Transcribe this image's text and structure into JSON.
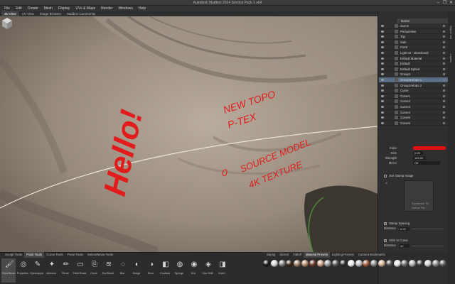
{
  "window": {
    "title": "Autodesk Mudbox 2014 Service Pack 1 x64",
    "controls": [
      "–",
      "❐",
      "✕"
    ]
  },
  "menu": {
    "items": [
      "File",
      "Edit",
      "Create",
      "Mesh",
      "Display",
      "UVs & Maps",
      "Render",
      "Windows",
      "Help"
    ]
  },
  "view_tabs": {
    "items": [
      "3D View",
      "UV View",
      "Image Browser",
      "Mudbox Community"
    ],
    "active": 0
  },
  "viewport": {
    "annotations": {
      "hello": "Hello!",
      "new_topo": "NEW TOPO",
      "ptex": "P-TEX",
      "zero": "0",
      "source_model": "SOURCE MODEL",
      "texture": "4K TEXTURE"
    },
    "annotation_color": "#e21b1b"
  },
  "outliner": {
    "header": "Name",
    "rows": [
      {
        "name": "Scene",
        "icon": "scene-icon"
      },
      {
        "name": "Perspective",
        "icon": "camera-icon"
      },
      {
        "name": "Top",
        "icon": "camera-icon"
      },
      {
        "name": "Side",
        "icon": "camera-icon"
      },
      {
        "name": "Front",
        "icon": "camera-icon"
      },
      {
        "name": "Light 01 - Directional",
        "icon": "light-icon"
      },
      {
        "name": "Default Material",
        "icon": "material-icon"
      },
      {
        "name": "Default",
        "icon": "material-icon"
      },
      {
        "name": "Default Sphed",
        "icon": "material-icon"
      },
      {
        "name": "Group1",
        "icon": "mesh-icon"
      },
      {
        "name": "Group1retopo 1",
        "icon": "mesh-icon"
      },
      {
        "name": "Group1retopo 2",
        "icon": "mesh-icon"
      },
      {
        "name": "Curve",
        "icon": "curve-icon"
      },
      {
        "name": "Curve1",
        "icon": "curve-icon"
      },
      {
        "name": "Curve2",
        "icon": "curve-icon"
      },
      {
        "name": "Curve3",
        "icon": "curve-icon"
      },
      {
        "name": "Curve4",
        "icon": "curve-icon"
      },
      {
        "name": "Curve5",
        "icon": "curve-icon"
      },
      {
        "name": "Curve6",
        "icon": "curve-icon"
      }
    ],
    "selected_index": 10
  },
  "properties": {
    "color_label": "Color",
    "color_value": "#e01010",
    "size_label": "Size",
    "size_value": "0.25",
    "strength_label": "Strength",
    "strength_value": "100.00",
    "mirror_label": "Mirror",
    "mirror_value": "Off"
  },
  "stamp": {
    "use_stamp_image": "Use Stamp Image",
    "randomize": "Randomize Tilt",
    "vertical_flip": "Vertical Flip"
  },
  "spacing": {
    "stamp_spacing_label": "Stamp Spacing",
    "distance_label": "Distance",
    "distance_value": "6.25",
    "stick_label": "Stick to Curve",
    "distance2_label": "Distance",
    "distance2_value": "40"
  },
  "tool_tabs": {
    "items": [
      "Sculpt Tools",
      "Paint Tools",
      "Curve Tools",
      "Pose Tools",
      "Select/Move Tools"
    ],
    "active": 1
  },
  "tools": [
    {
      "label": "Paint Brush",
      "icon": "paint-brush-icon"
    },
    {
      "label": "Projection",
      "icon": "projection-icon"
    },
    {
      "label": "Eyedropper",
      "icon": "eyedropper-icon"
    },
    {
      "label": "Airbrush",
      "icon": "airbrush-icon"
    },
    {
      "label": "Pencil",
      "icon": "pencil-icon"
    },
    {
      "label": "Paint Erase",
      "icon": "eraser-icon"
    },
    {
      "label": "Clone",
      "icon": "clone-icon"
    },
    {
      "label": "Dry Brush",
      "icon": "dry-brush-icon"
    },
    {
      "label": "Blur",
      "icon": "blur-icon"
    },
    {
      "label": "Dodge",
      "icon": "dodge-icon"
    },
    {
      "label": "Burn",
      "icon": "burn-icon"
    },
    {
      "label": "Contrast",
      "icon": "contrast-icon"
    },
    {
      "label": "Sponge",
      "icon": "sponge-icon"
    },
    {
      "label": "Hue",
      "icon": "hue-icon"
    },
    {
      "label": "Hue Shift",
      "icon": "hue-shift-icon"
    },
    {
      "label": "Invert",
      "icon": "invert-icon"
    }
  ],
  "tools_active": 0,
  "material_tabs": {
    "items": [
      "Stamp",
      "Stencil",
      "Falloff",
      "Material Presets",
      "Lighting Presets",
      "Camera Bookmarks"
    ],
    "active": 3
  },
  "material_presets": [
    "#1a1a1a",
    "#d8d8d8",
    "#7a7a7a",
    "#3b2a1d",
    "#a0826a",
    "#b48c6e",
    "#6e3c2c",
    "#c9a08a",
    "#9a9a9a",
    "#5a5a5a",
    "#2d2d2d",
    "#f0f0f0",
    "#c0c0c0",
    "#a45a3a",
    "#888888",
    "#d0b090",
    "#4c4c4c",
    "#e8e8e8",
    "#6a6a6a",
    "#b0b0b0",
    "#3d3d3d",
    "#cfcfcf",
    "#8a8a8a",
    "#5e5e5e"
  ]
}
